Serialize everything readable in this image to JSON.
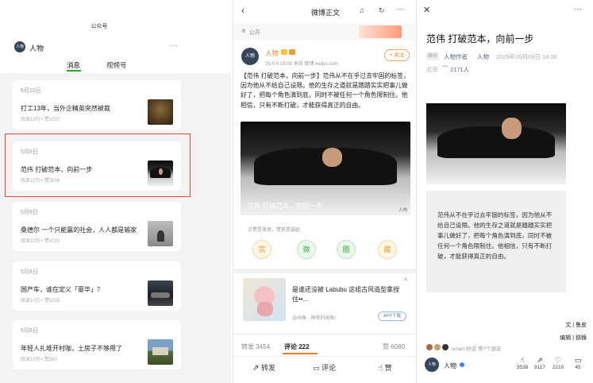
{
  "left": {
    "header_title": "公众号",
    "account_name": "人物",
    "tabs": [
      "消息",
      "视频号"
    ],
    "articles": [
      {
        "date": "6月10日",
        "title": "打工13年，当外企精英突然被裁",
        "meta": "阅读10万+  赞1037"
      },
      {
        "date": "5月9日",
        "title": "范伟 打破范本，向前一步",
        "meta": "阅读10万+  赞3538"
      },
      {
        "date": "5月9日",
        "title": "桑德尔 一个只能赢的社会，人人都是输家",
        "meta": "阅读10万+  赞4720"
      },
      {
        "date": "5月8日",
        "title": "国产车，谁在定义「豪华」？",
        "meta": "阅读10万+  赞5255"
      },
      {
        "date": "5月8日",
        "title": "年轻人扎堆开村咖，土房子不够用了",
        "meta": "阅读10万+  赞580"
      }
    ],
    "highlight_color": "#e8473a"
  },
  "middle": {
    "nav_title": "微博正文",
    "public_label": "公开",
    "author": "人物",
    "post_meta": "25-5-9 18:00  来自 微博 weibo.com",
    "follow_label": "+ 关注",
    "body_text": "【范伟 打破范本，向前一步】范伟从不在乎过去牢固的标签，因为他从不给自己设限。他的生存之道就是踏踏实实把事儿做好了，把每个角色演到底，同时不被任何一个角色限制住。他相信，只有不断打破，才能获得真正的自由。",
    "image_caption": "范伟 打破范本，向前一步",
    "image_watermark": "人物",
    "reward_hint": "点赞是美意，赞赏是鼓励",
    "reward_icons": [
      "赏",
      "微",
      "圈",
      "藏"
    ],
    "ad_title": "是谁还没被 Labubu 这组古风造型拿捏住••...",
    "ad_source": "@闲鱼 - 神奇的闲鱼!",
    "ad_button": "APP下载",
    "stats": {
      "repost": "转发 3454",
      "comment": "评论 222",
      "like": "赞 6080"
    },
    "bottom_actions": [
      "转发",
      "评论",
      "赞"
    ]
  },
  "right": {
    "title": "范伟 打破范本，向前一步",
    "badge": "原创",
    "author_label": "人物作者",
    "author": "人物",
    "date": "2025年05月09日 18:00",
    "location": "北京",
    "listen_count": "2171人",
    "quote": "范伟从不在乎过去牢固的标签，因为他从不给自己设限。他的生存之道就是踏踏实实把事儿做好了，把每个角色演到底，同时不被任何一个角色限制住。他相信，只有不断打破，才能获得真正的自由。",
    "credit_text": "文 | 鲁皮",
    "credit_edit": "编辑 | 猕猴",
    "social_line": "smart 好运 等7个朋友",
    "account_name": "人物",
    "action_counts": [
      "3538",
      "9117",
      "2210",
      "45"
    ]
  }
}
